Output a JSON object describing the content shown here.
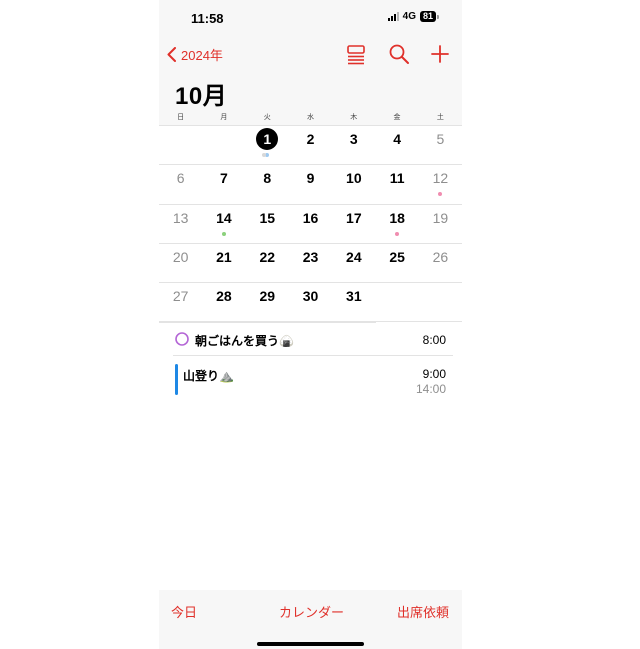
{
  "status": {
    "time": "11:58",
    "network": "4G",
    "battery": "81"
  },
  "nav": {
    "back_label": "2024年"
  },
  "month_title": "10月",
  "weekdays": [
    "日",
    "月",
    "火",
    "水",
    "木",
    "金",
    "土"
  ],
  "weeks": [
    [
      "",
      "",
      "1",
      "2",
      "3",
      "4",
      "5"
    ],
    [
      "6",
      "7",
      "8",
      "9",
      "10",
      "11",
      "12"
    ],
    [
      "13",
      "14",
      "15",
      "16",
      "17",
      "18",
      "19"
    ],
    [
      "20",
      "21",
      "22",
      "23",
      "24",
      "25",
      "26"
    ],
    [
      "27",
      "28",
      "29",
      "30",
      "31",
      "",
      ""
    ]
  ],
  "today": "1",
  "colors": {
    "accent": "#e0302a",
    "reminder_circle": "#b466d6",
    "event_bar": "#1e88e5",
    "dot_pink": "#f08db0",
    "dot_green": "#8bd17c",
    "dot_blue": "#9ec9f0"
  },
  "events": [
    {
      "title": "朝ごはんを買う",
      "emoji": "🍙",
      "time": "8:00"
    },
    {
      "title": "山登り",
      "emoji": "⛰️",
      "start": "9:00",
      "end": "14:00"
    }
  ],
  "tabs": {
    "today": "今日",
    "calendars": "カレンダー",
    "inbox": "出席依頼"
  }
}
